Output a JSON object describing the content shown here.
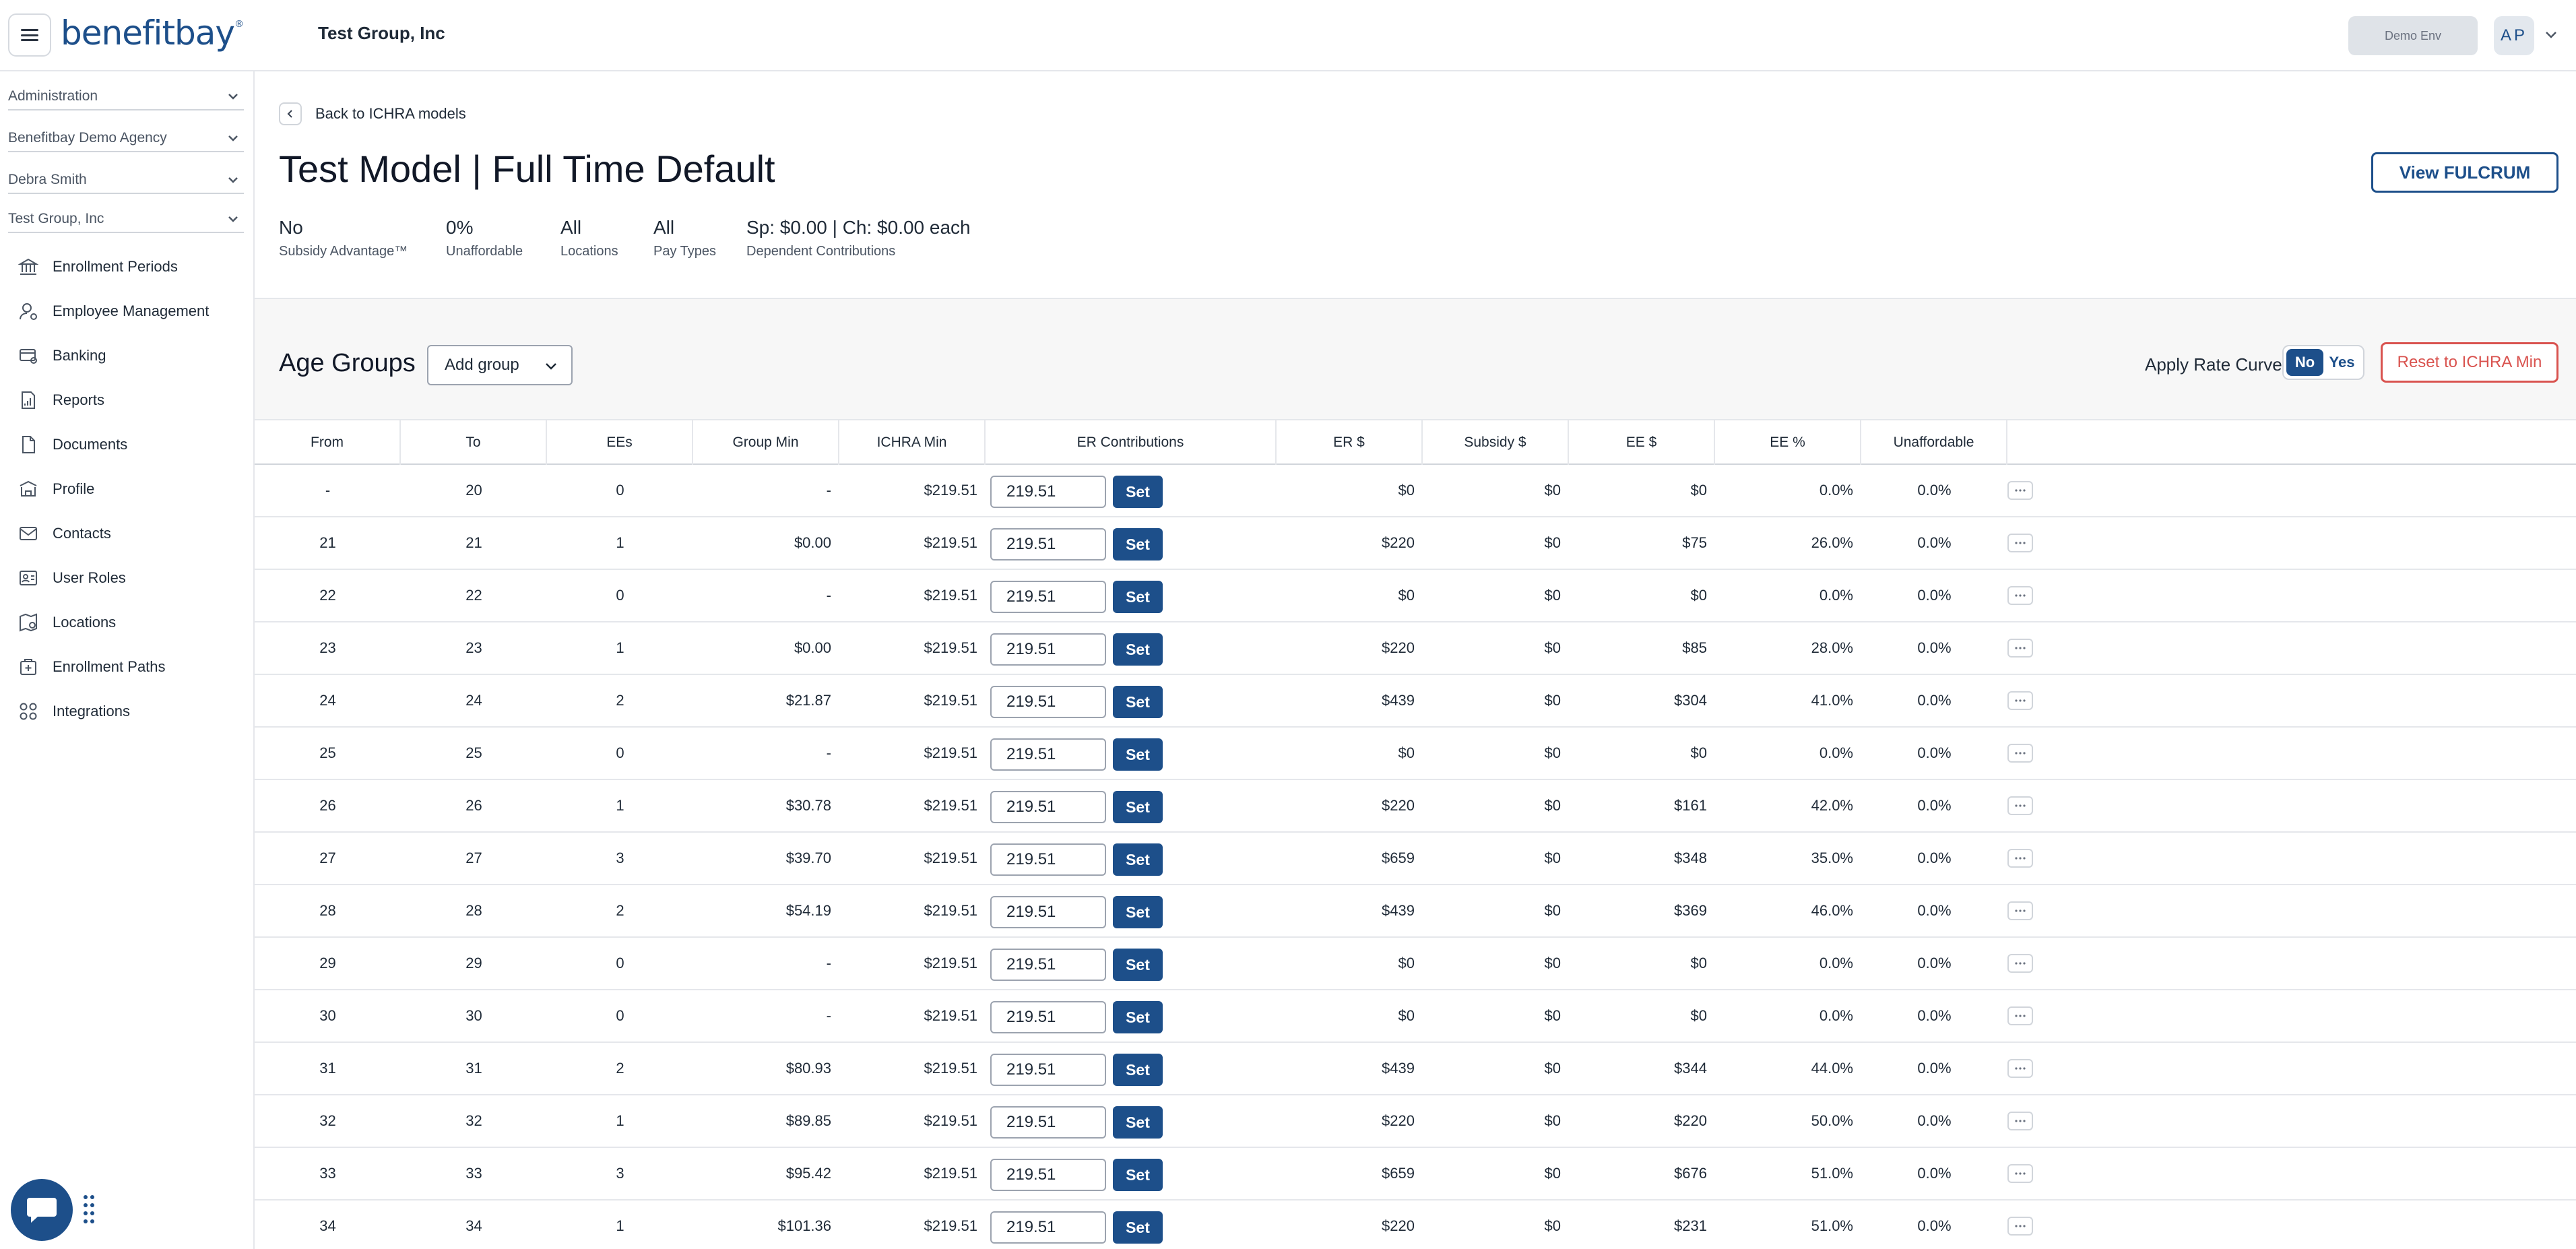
{
  "header": {
    "brand": "benefitbay",
    "company": "Test Group, Inc",
    "env_label": "Demo Env",
    "user_initials": "AP"
  },
  "sidebar": {
    "contexts": [
      "Administration",
      "Benefitbay Demo Agency",
      "Debra Smith",
      "Test Group, Inc"
    ],
    "items": [
      {
        "label": "Enrollment Periods",
        "icon": "bank-icon"
      },
      {
        "label": "Employee Management",
        "icon": "user-gear-icon"
      },
      {
        "label": "Banking",
        "icon": "bank-card-icon"
      },
      {
        "label": "Reports",
        "icon": "report-icon"
      },
      {
        "label": "Documents",
        "icon": "document-icon"
      },
      {
        "label": "Profile",
        "icon": "building-icon"
      },
      {
        "label": "Contacts",
        "icon": "mail-icon"
      },
      {
        "label": "User Roles",
        "icon": "id-card-icon"
      },
      {
        "label": "Locations",
        "icon": "location-icon"
      },
      {
        "label": "Enrollment Paths",
        "icon": "plus-box-icon"
      },
      {
        "label": "Integrations",
        "icon": "integrations-icon"
      }
    ]
  },
  "main": {
    "back_label": "Back to ICHRA models",
    "title": "Test Model | Full Time Default",
    "view_button": "View FULCRUM",
    "summary": [
      {
        "value": "No",
        "label": "Subsidy Advantage™"
      },
      {
        "value": "0%",
        "label": "Unaffordable"
      },
      {
        "value": "All",
        "label": "Locations"
      },
      {
        "value": "All",
        "label": "Pay Types"
      },
      {
        "value": "Sp: $0.00 | Ch: $0.00 each",
        "label": "Dependent Contributions"
      }
    ],
    "age_groups_title": "Age Groups",
    "add_group_label": "Add group",
    "rate_curve_label": "Apply Rate Curve",
    "toggle_no": "No",
    "toggle_yes": "Yes",
    "rate_curve_selected": "No",
    "reset_label": "Reset to ICHRA Min",
    "set_label": "Set",
    "columns": [
      "From",
      "To",
      "EEs",
      "Group Min",
      "ICHRA Min",
      "ER Contributions",
      "ER $",
      "Subsidy $",
      "EE $",
      "EE %",
      "Unaffordable"
    ],
    "rows": [
      {
        "from": "-",
        "to": "20",
        "ees": "0",
        "group_min": "-",
        "ichra_min": "$219.51",
        "er_contrib": "219.51",
        "er": "$0",
        "subsidy": "$0",
        "ee": "$0",
        "ee_pct": "0.0%",
        "unaff": "0.0%"
      },
      {
        "from": "21",
        "to": "21",
        "ees": "1",
        "group_min": "$0.00",
        "ichra_min": "$219.51",
        "er_contrib": "219.51",
        "er": "$220",
        "subsidy": "$0",
        "ee": "$75",
        "ee_pct": "26.0%",
        "unaff": "0.0%"
      },
      {
        "from": "22",
        "to": "22",
        "ees": "0",
        "group_min": "-",
        "ichra_min": "$219.51",
        "er_contrib": "219.51",
        "er": "$0",
        "subsidy": "$0",
        "ee": "$0",
        "ee_pct": "0.0%",
        "unaff": "0.0%"
      },
      {
        "from": "23",
        "to": "23",
        "ees": "1",
        "group_min": "$0.00",
        "ichra_min": "$219.51",
        "er_contrib": "219.51",
        "er": "$220",
        "subsidy": "$0",
        "ee": "$85",
        "ee_pct": "28.0%",
        "unaff": "0.0%"
      },
      {
        "from": "24",
        "to": "24",
        "ees": "2",
        "group_min": "$21.87",
        "ichra_min": "$219.51",
        "er_contrib": "219.51",
        "er": "$439",
        "subsidy": "$0",
        "ee": "$304",
        "ee_pct": "41.0%",
        "unaff": "0.0%"
      },
      {
        "from": "25",
        "to": "25",
        "ees": "0",
        "group_min": "-",
        "ichra_min": "$219.51",
        "er_contrib": "219.51",
        "er": "$0",
        "subsidy": "$0",
        "ee": "$0",
        "ee_pct": "0.0%",
        "unaff": "0.0%"
      },
      {
        "from": "26",
        "to": "26",
        "ees": "1",
        "group_min": "$30.78",
        "ichra_min": "$219.51",
        "er_contrib": "219.51",
        "er": "$220",
        "subsidy": "$0",
        "ee": "$161",
        "ee_pct": "42.0%",
        "unaff": "0.0%"
      },
      {
        "from": "27",
        "to": "27",
        "ees": "3",
        "group_min": "$39.70",
        "ichra_min": "$219.51",
        "er_contrib": "219.51",
        "er": "$659",
        "subsidy": "$0",
        "ee": "$348",
        "ee_pct": "35.0%",
        "unaff": "0.0%"
      },
      {
        "from": "28",
        "to": "28",
        "ees": "2",
        "group_min": "$54.19",
        "ichra_min": "$219.51",
        "er_contrib": "219.51",
        "er": "$439",
        "subsidy": "$0",
        "ee": "$369",
        "ee_pct": "46.0%",
        "unaff": "0.0%"
      },
      {
        "from": "29",
        "to": "29",
        "ees": "0",
        "group_min": "-",
        "ichra_min": "$219.51",
        "er_contrib": "219.51",
        "er": "$0",
        "subsidy": "$0",
        "ee": "$0",
        "ee_pct": "0.0%",
        "unaff": "0.0%"
      },
      {
        "from": "30",
        "to": "30",
        "ees": "0",
        "group_min": "-",
        "ichra_min": "$219.51",
        "er_contrib": "219.51",
        "er": "$0",
        "subsidy": "$0",
        "ee": "$0",
        "ee_pct": "0.0%",
        "unaff": "0.0%"
      },
      {
        "from": "31",
        "to": "31",
        "ees": "2",
        "group_min": "$80.93",
        "ichra_min": "$219.51",
        "er_contrib": "219.51",
        "er": "$439",
        "subsidy": "$0",
        "ee": "$344",
        "ee_pct": "44.0%",
        "unaff": "0.0%"
      },
      {
        "from": "32",
        "to": "32",
        "ees": "1",
        "group_min": "$89.85",
        "ichra_min": "$219.51",
        "er_contrib": "219.51",
        "er": "$220",
        "subsidy": "$0",
        "ee": "$220",
        "ee_pct": "50.0%",
        "unaff": "0.0%"
      },
      {
        "from": "33",
        "to": "33",
        "ees": "3",
        "group_min": "$95.42",
        "ichra_min": "$219.51",
        "er_contrib": "219.51",
        "er": "$659",
        "subsidy": "$0",
        "ee": "$676",
        "ee_pct": "51.0%",
        "unaff": "0.0%"
      },
      {
        "from": "34",
        "to": "34",
        "ees": "1",
        "group_min": "$101.36",
        "ichra_min": "$219.51",
        "er_contrib": "219.51",
        "er": "$220",
        "subsidy": "$0",
        "ee": "$231",
        "ee_pct": "51.0%",
        "unaff": "0.0%"
      }
    ]
  },
  "colors": {
    "brand": "#1d4f8a",
    "danger": "#d9534f"
  }
}
